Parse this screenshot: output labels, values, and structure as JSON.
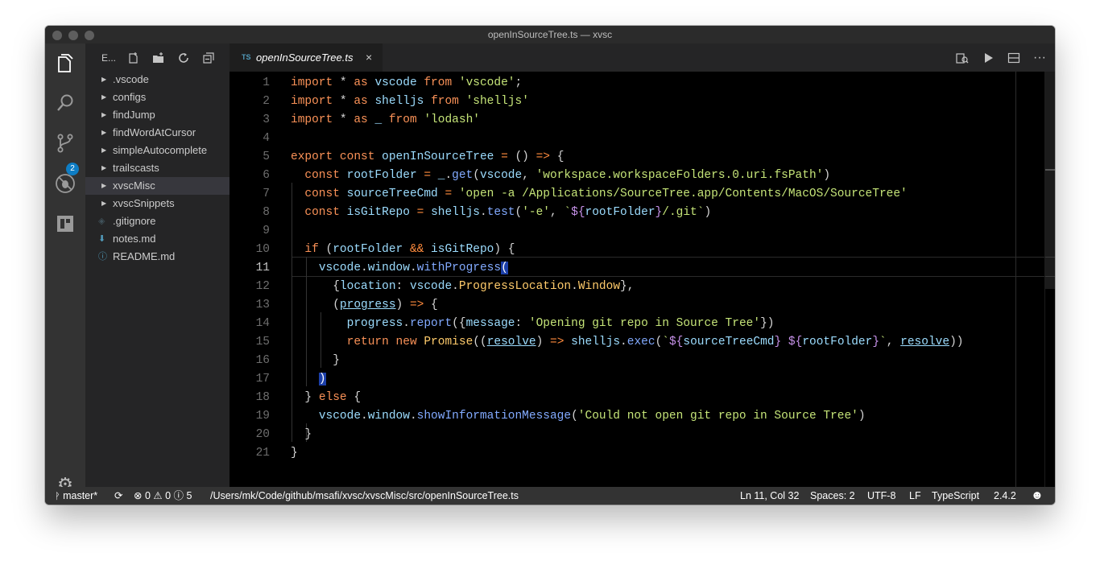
{
  "window": {
    "title": "openInSourceTree.ts — xvsc"
  },
  "activity_bar": {
    "scm_badge": "2"
  },
  "sidebar": {
    "title": "E...",
    "items": [
      {
        "label": ".vscode",
        "type": "folder"
      },
      {
        "label": "configs",
        "type": "folder"
      },
      {
        "label": "findJump",
        "type": "folder"
      },
      {
        "label": "findWordAtCursor",
        "type": "folder"
      },
      {
        "label": "simpleAutocomplete",
        "type": "folder"
      },
      {
        "label": "trailscasts",
        "type": "folder"
      },
      {
        "label": "xvscMisc",
        "type": "folder",
        "selected": true
      },
      {
        "label": "xvscSnippets",
        "type": "folder"
      },
      {
        "label": ".gitignore",
        "type": "file",
        "icon": "git-icon"
      },
      {
        "label": "notes.md",
        "type": "file",
        "icon": "markdown-icon"
      },
      {
        "label": "README.md",
        "type": "file",
        "icon": "info-icon"
      }
    ]
  },
  "tab": {
    "lang": "TS",
    "name": "openInSourceTree.ts",
    "close": "×"
  },
  "editor": {
    "current_line": 11,
    "lines": [
      "import * as vscode from 'vscode';",
      "import * as shelljs from 'shelljs'",
      "import * as _ from 'lodash'",
      "",
      "export const openInSourceTree = () => {",
      "  const rootFolder = _.get(vscode, 'workspace.workspaceFolders.0.uri.fsPath')",
      "  const sourceTreeCmd = 'open -a /Applications/SourceTree.app/Contents/MacOS/SourceTree'",
      "  const isGitRepo = shelljs.test('-e', `${rootFolder}/.git`)",
      "",
      "  if (rootFolder && isGitRepo) {",
      "    vscode.window.withProgress(",
      "      {location: vscode.ProgressLocation.Window},",
      "      (progress) => {",
      "        progress.report({message: 'Opening git repo in Source Tree'})",
      "        return new Promise((resolve) => shelljs.exec(`${sourceTreeCmd} ${rootFolder}`, resolve))",
      "      }",
      "    )",
      "  } else {",
      "    vscode.window.showInformationMessage('Could not open git repo in Source Tree')",
      "  }",
      "}"
    ]
  },
  "statusbar": {
    "branch": "master*",
    "errors": "0",
    "warnings": "0",
    "infos": "5",
    "path": "/Users/mk/Code/github/msafi/xvsc/xvscMisc/src/openInSourceTree.ts",
    "position": "Ln 11, Col 32",
    "spaces": "Spaces: 2",
    "encoding": "UTF-8",
    "eol": "LF",
    "language": "TypeScript",
    "version": "2.4.2"
  },
  "colors": {
    "accent": "#0e7dc4",
    "keyword": "#f99157",
    "string": "#c5e478"
  }
}
